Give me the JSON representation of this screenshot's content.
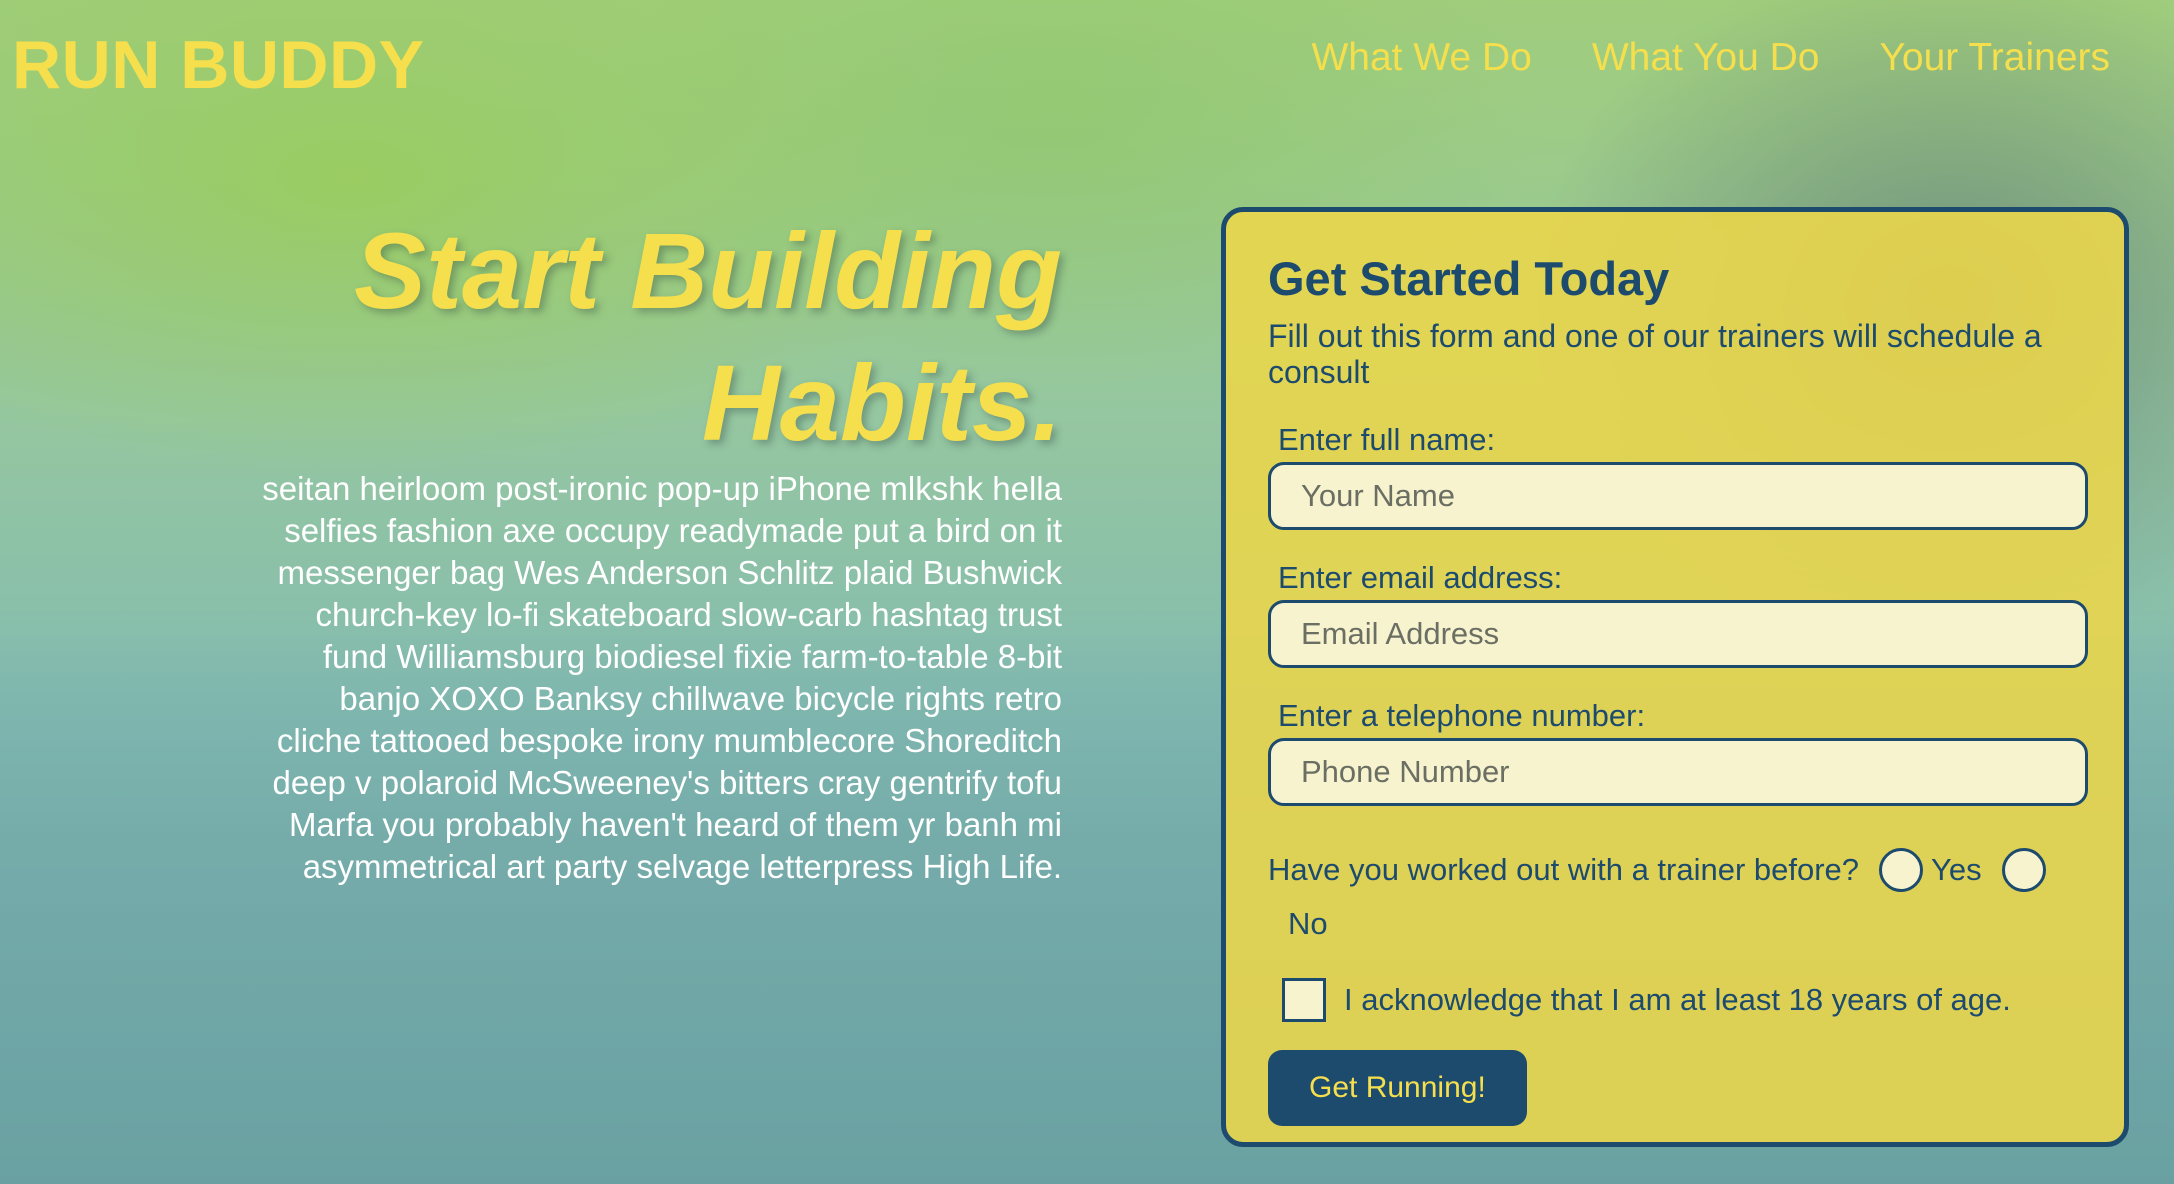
{
  "header": {
    "logo": "RUN BUDDY",
    "nav": [
      "What We Do",
      "What You Do",
      "Your Trainers"
    ]
  },
  "hero": {
    "title": "Start Building Habits.",
    "body": "seitan heirloom post-ironic pop-up iPhone mlkshk hella selfies fashion axe occupy readymade put a bird on it messenger bag Wes Anderson Schlitz plaid Bushwick church-key lo-fi skateboard slow-carb hashtag trust fund Williamsburg biodiesel fixie farm-to-table 8-bit banjo XOXO Banksy chillwave bicycle rights retro cliche tattooed bespoke irony mumblecore Shoreditch deep v polaroid McSweeney's bitters cray gentrify tofu Marfa you probably haven't heard of them yr banh mi asymmetrical art party selvage letterpress High Life."
  },
  "form": {
    "title": "Get Started Today",
    "intro": "Fill out this form and one of our trainers will schedule a consult",
    "name": {
      "label": "Enter full name:",
      "placeholder": "Your Name",
      "value": ""
    },
    "email": {
      "label": "Enter email address:",
      "placeholder": "Email Address",
      "value": ""
    },
    "phone": {
      "label": "Enter a telephone number:",
      "placeholder": "Phone Number",
      "value": ""
    },
    "trainer_question": "Have you worked out with a trainer before?",
    "yes_label": "Yes",
    "no_label": "No",
    "acknowledge_label": "I acknowledge that I am at least 18 years of age.",
    "submit_label": "Get Running!"
  },
  "colors": {
    "accent_yellow": "#f5df4d",
    "navy": "#1d4b6e",
    "card_bg": "#ecd64a",
    "input_bg": "#f7f3cf"
  }
}
